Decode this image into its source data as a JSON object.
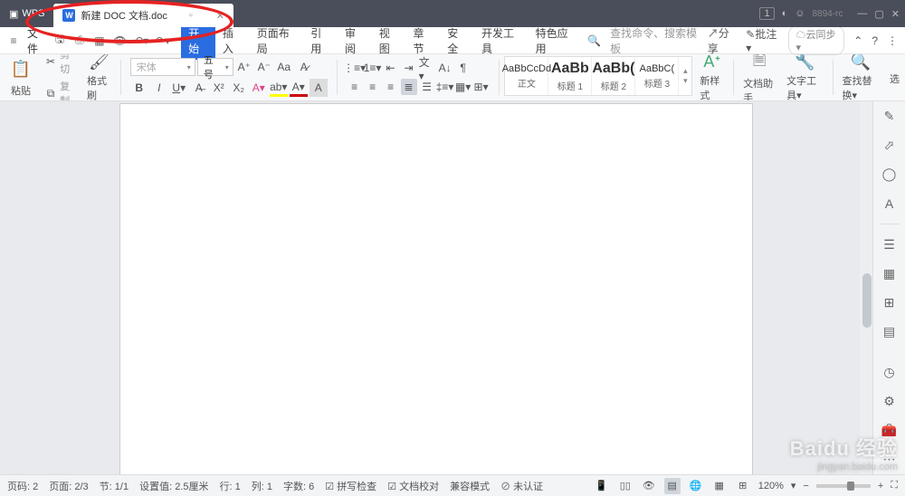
{
  "titlebar": {
    "brand": "WPS",
    "tab_name": "新建 DOC 文档.doc",
    "version": "8894-rc",
    "page_indicator": "1"
  },
  "quick": {
    "menu_glyph": "≡",
    "file_label": "文件"
  },
  "menu": {
    "tabs": [
      "开始",
      "插入",
      "页面布局",
      "引用",
      "审阅",
      "视图",
      "章节",
      "安全",
      "开发工具",
      "特色应用"
    ],
    "active": 0,
    "search_placeholder": "查找命令、搜索模板",
    "share": "分享",
    "annotate": "批注",
    "cloud": "云同步"
  },
  "ribbon": {
    "cut": "剪切",
    "copy": "复制",
    "paste": "粘贴",
    "format_painter": "格式刷",
    "font_name": "宋体",
    "font_size": "五号",
    "styles": [
      {
        "preview": "AaBbCcDd",
        "name": "正文",
        "big": false
      },
      {
        "preview": "AaBb",
        "name": "标题 1",
        "big": true
      },
      {
        "preview": "AaBb(",
        "name": "标题 2",
        "big": true
      },
      {
        "preview": "AaBbC(",
        "name": "标题 3",
        "big": false
      }
    ],
    "new_style": "新样式",
    "doc_helper": "文档助手",
    "text_tools": "文字工具",
    "find_replace": "查找替换",
    "select": "选"
  },
  "status": {
    "page_no_lbl": "页码:",
    "page_no": "2",
    "pages_lbl": "页面:",
    "pages": "2/3",
    "section_lbl": "节:",
    "section": "1/1",
    "set_lbl": "设置值:",
    "set_val": "2.5厘米",
    "row_lbl": "行:",
    "row": "1",
    "col_lbl": "列:",
    "col": "1",
    "chars_lbl": "字数:",
    "chars": "6",
    "spellcheck": "拼写检查",
    "doc_proof": "文档校对",
    "compat": "兼容模式",
    "unauth": "未认证",
    "zoom": "120%"
  },
  "watermark": {
    "line1": "Baidu 经验",
    "line2": "jingyan.baidu.com"
  }
}
